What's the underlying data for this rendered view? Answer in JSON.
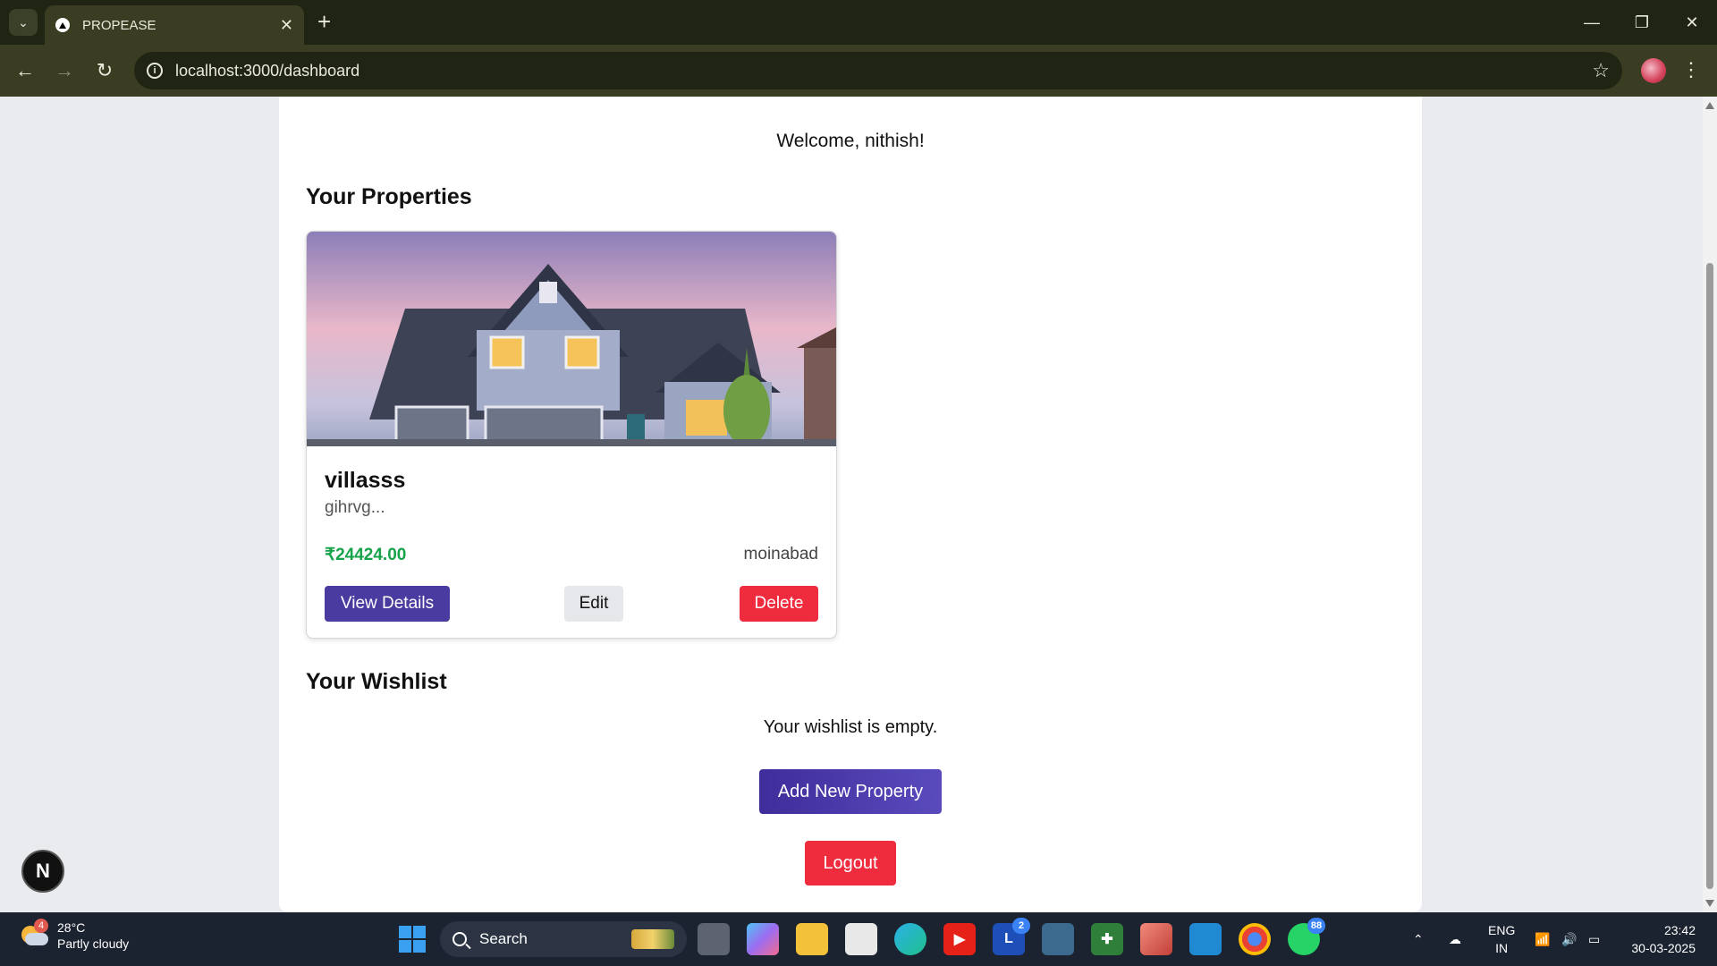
{
  "browser": {
    "tab_title": "PROPEASE",
    "url": "localhost:3000/dashboard"
  },
  "page": {
    "welcome": "Welcome, nithish!",
    "properties_heading": "Your Properties",
    "property": {
      "name": "villasss",
      "description": "gihrvg...",
      "price": "₹24424.00",
      "location": "moinabad",
      "view_label": "View Details",
      "edit_label": "Edit",
      "delete_label": "Delete"
    },
    "wishlist_heading": "Your Wishlist",
    "wishlist_empty": "Your wishlist is empty.",
    "add_property_label": "Add New Property",
    "logout_label": "Logout",
    "dev_badge": "N"
  },
  "taskbar": {
    "weather_temp": "28°C",
    "weather_desc": "Partly cloudy",
    "weather_badge": "4",
    "search_label": "Search",
    "apps": [
      {
        "name": "task-view-icon"
      },
      {
        "name": "copilot-icon"
      },
      {
        "name": "file-explorer-icon"
      },
      {
        "name": "microsoft-store-icon"
      },
      {
        "name": "edge-icon"
      },
      {
        "name": "youtube-icon"
      },
      {
        "name": "l-app-icon",
        "badge": "2"
      },
      {
        "name": "mysql-workbench-icon"
      },
      {
        "name": "cross-app-icon"
      },
      {
        "name": "paint-icon"
      },
      {
        "name": "vscode-icon"
      },
      {
        "name": "chrome-icon"
      },
      {
        "name": "whatsapp-icon",
        "badge": "88"
      }
    ],
    "lang_top": "ENG",
    "lang_bottom": "IN",
    "time": "23:42",
    "date": "30-03-2025"
  },
  "colors": {
    "primary": "#4a3ba0",
    "danger": "#ef2b3e",
    "price": "#16a34a",
    "chrome_dark": "#1f2413",
    "chrome_toolbar": "#3a3d22"
  }
}
